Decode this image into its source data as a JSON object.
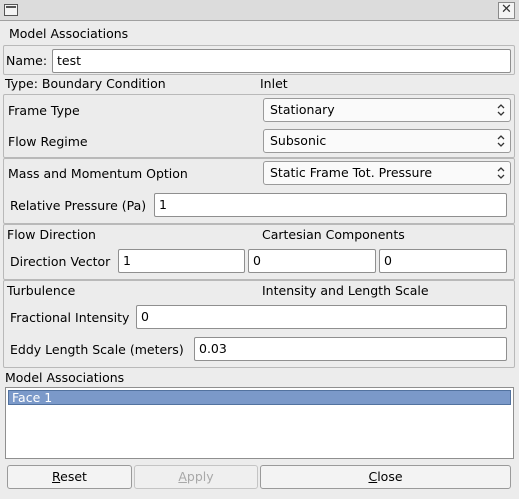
{
  "header": {
    "title": "Model Associations"
  },
  "name": {
    "label": "Name:",
    "value": "test"
  },
  "type": {
    "label": "Type: Boundary Condition",
    "value": "Inlet"
  },
  "frame": {
    "label": "Frame Type",
    "value": "Stationary"
  },
  "flow": {
    "label": "Flow Regime",
    "value": "Subsonic"
  },
  "mass": {
    "label": "Mass and Momentum Option",
    "value": "Static Frame Tot. Pressure"
  },
  "pressure": {
    "label": "Relative Pressure (Pa)",
    "value": "1"
  },
  "direction": {
    "label": "Flow Direction",
    "mode": "Cartesian Components",
    "vector_label": "Direction Vector",
    "x": "1",
    "y": "0",
    "z": "0"
  },
  "turbulence": {
    "label": "Turbulence",
    "mode": "Intensity and Length Scale",
    "intensity_label": "Fractional Intensity",
    "intensity": "0",
    "eddy_label": "Eddy Length Scale (meters)",
    "eddy": "0.03"
  },
  "associations": {
    "label": "Model Associations",
    "items": [
      "Face 1"
    ]
  },
  "buttons": {
    "reset_mn": "R",
    "reset_rest": "eset",
    "apply_mn": "A",
    "apply_rest": "pply",
    "close_mn": "C",
    "close_rest": "lose"
  },
  "colors": {
    "selection": "#7b99c9",
    "window_bg": "#ececec"
  }
}
